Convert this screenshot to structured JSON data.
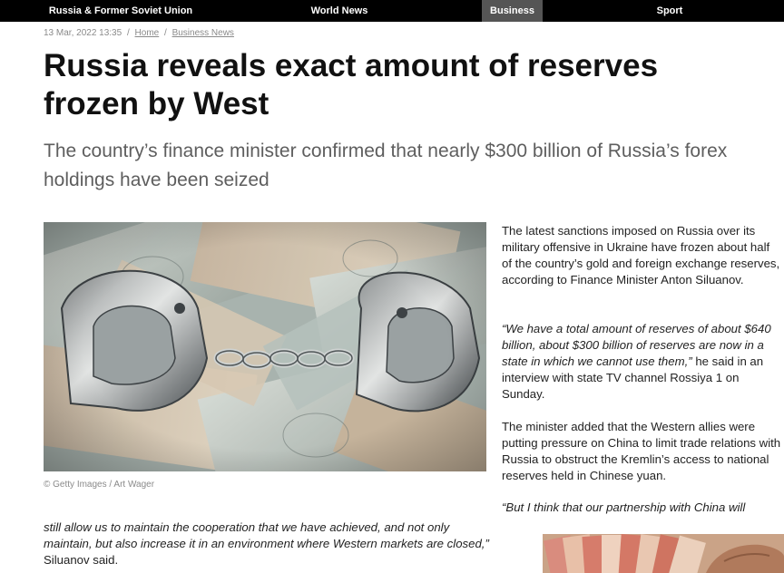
{
  "nav": {
    "items": [
      {
        "label": "Russia & Former Soviet Union",
        "active": false
      },
      {
        "label": "World News",
        "active": false
      },
      {
        "label": "Business",
        "active": true
      },
      {
        "label": "Sport",
        "active": false
      }
    ]
  },
  "article": {
    "date": "13 Mar, 2022 13:35",
    "breadcrumb": {
      "separator": "/",
      "home": "Home",
      "section": "Business News"
    },
    "title": "Russia reveals exact amount of reserves frozen by West",
    "subtitle": "The country’s finance minister confirmed that nearly $300 billion of Russia’s forex holdings have been seized",
    "image": {
      "alt": "handcuffs-on-banknotes",
      "caption": "© Getty Images / Art Wager"
    },
    "paragraphs": {
      "p1": "The latest sanctions imposed on Russia over its military offensive in Ukraine have frozen about half of the country’s gold and foreign exchange reserves, according to Finance Minister Anton Siluanov.",
      "p2_quote": "“We have a total amount of reserves of about $640 billion, about $300 billion of reserves are now in a state in which we cannot use them,”",
      "p2_text": " he said in an interview with state TV channel Rossiya 1 on Sunday.",
      "p3": "The minister added that the Western allies were putting pressure on China to limit trade relations with Russia to obstruct the Kremlin’s access to national reserves held in Chinese yuan.",
      "p4_quote_start": "“But I think that our partnership with China will",
      "p4_quote_rest": "still allow us to maintain the cooperation that we have achieved, and not only maintain, but also increase it in an environment where Western markets are closed,”",
      "p4_text": " Siluanov said."
    }
  },
  "colors": {
    "nav_bg": "#000000",
    "nav_active_bg": "#555555",
    "meta_gray": "#8a8a8a",
    "subtitle_gray": "#5e5e5e"
  }
}
